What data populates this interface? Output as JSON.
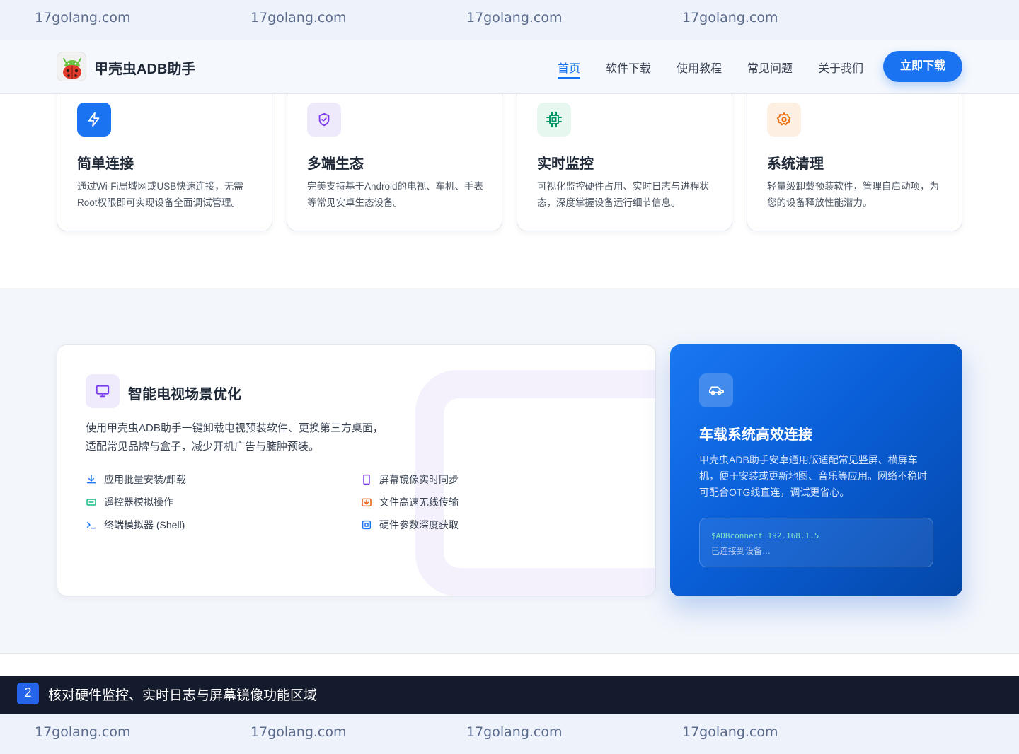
{
  "watermark": {
    "text": "17golang.com"
  },
  "header": {
    "brand": "甲壳虫ADB助手",
    "nav": [
      "首页",
      "软件下载",
      "使用教程",
      "常见问题",
      "关于我们"
    ],
    "cta": "立即下载"
  },
  "features": [
    {
      "title": "简单连接",
      "desc": "通过Wi-Fi局域网或USB快速连接，无需Root权限即可实现设备全面调试管理。",
      "icon": "lightning-icon"
    },
    {
      "title": "多端生态",
      "desc": "完美支持基于Android的电视、车机、手表等常见安卓生态设备。",
      "icon": "shield-icon"
    },
    {
      "title": "实时监控",
      "desc": "可视化监控硬件占用、实时日志与进程状态，深度掌握设备运行细节信息。",
      "icon": "chip-icon"
    },
    {
      "title": "系统清理",
      "desc": "轻量级卸载预装软件，管理自启动项，为您的设备释放性能潜力。",
      "icon": "gear-icon"
    }
  ],
  "tv": {
    "title": "智能电视场景优化",
    "desc": "使用甲壳虫ADB助手一键卸载电视预装软件、更换第三方桌面，适配常见品牌与盒子，减少开机广告与臃肿预装。",
    "features": [
      "应用批量安装/卸载",
      "屏幕镜像实时同步",
      "遥控器模拟操作",
      "文件高速无线传输",
      "终端模拟器 (Shell)",
      "硬件参数深度获取"
    ]
  },
  "car": {
    "title": "车载系统高效连接",
    "desc": "甲壳虫ADB助手安卓通用版适配常见竖屏、横屏车机，便于安装或更新地图、音乐等应用。网络不稳时可配合OTG线直连，调试更省心。",
    "terminal_cmd": "$ADBconnect 192.168.1.5",
    "terminal_out": "已连接到设备…"
  },
  "caption": {
    "number": "2",
    "text": "核对硬件监控、实时日志与屏幕镜像功能区域"
  },
  "colors": {
    "primary": "#1a73f0",
    "caption_bg": "#141b2d",
    "tv_accent": "#7c3aed",
    "car_bg": "#0a5fd8"
  }
}
